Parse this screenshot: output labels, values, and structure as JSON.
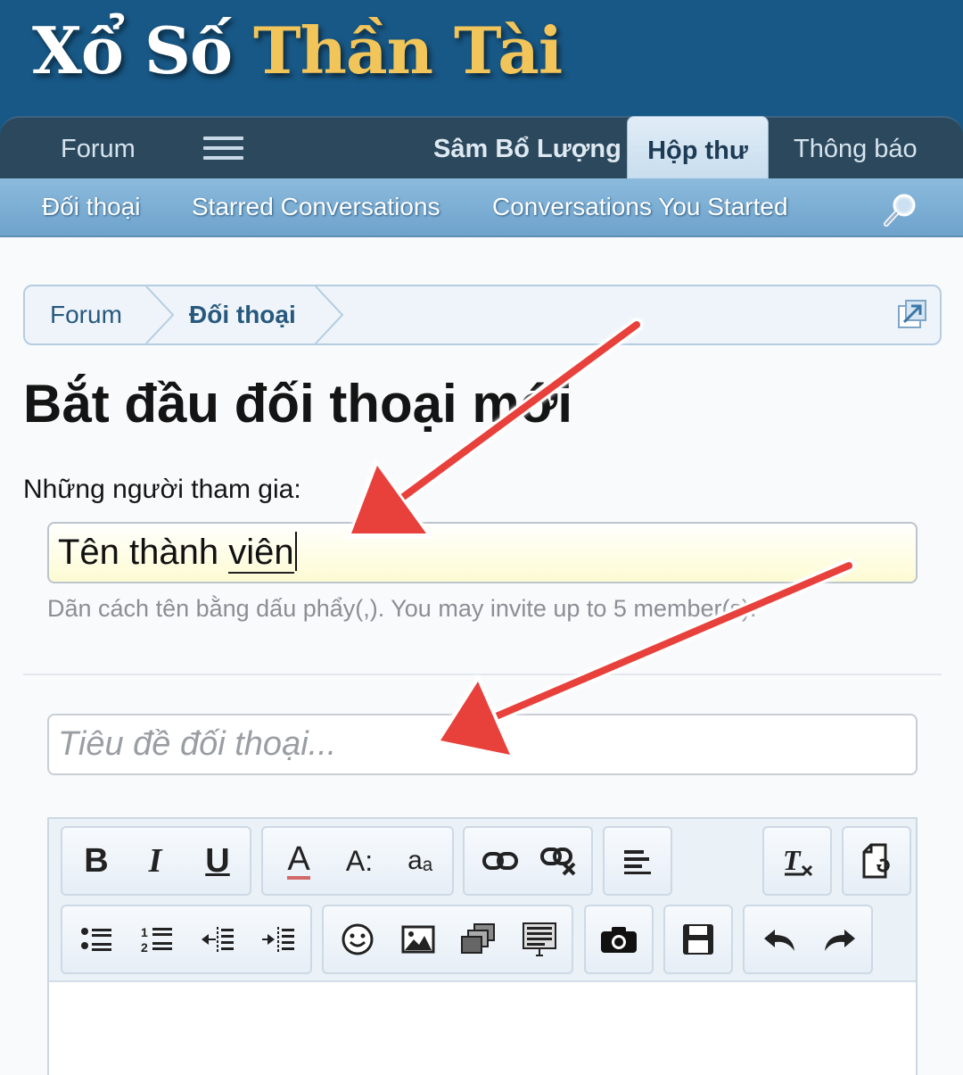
{
  "header": {
    "logo_part1": "Xổ Số ",
    "logo_part2": "Thần Tài"
  },
  "nav": {
    "forum": "Forum",
    "menu_icon": "hamburger-icon",
    "sam": "Sâm Bổ Lượng",
    "hop_thu": "Hộp thư",
    "thong_bao": "Thông báo"
  },
  "subnav": {
    "doi_thoai": "Đối thoại",
    "starred": "Starred Conversations",
    "started": "Conversations You Started",
    "search_icon": "search-icon"
  },
  "breadcrumb": {
    "forum": "Forum",
    "doi_thoai": "Đối thoại"
  },
  "page": {
    "title": "Bắt đầu đối thoại mới"
  },
  "form": {
    "participants_label": "Những người tham gia:",
    "participants_value_1": "Tên thành ",
    "participants_value_2": "viên",
    "participants_hint": "Dãn cách tên bằng dấu phẩy(,). You may invite up to 5 member(s).",
    "title_placeholder": "Tiêu đề đối thoại..."
  },
  "toolbar": {
    "bold": "B",
    "italic": "I",
    "underline": "U",
    "font_color": "A",
    "font_size": "A:",
    "font_family": "aₐ",
    "icons": [
      "link-icon",
      "unlink-icon",
      "align-icon",
      "remove-format-icon",
      "restore-draft-icon",
      "bullet-list-icon",
      "numbered-list-icon",
      "outdent-icon",
      "indent-icon",
      "smiley-icon",
      "image-icon",
      "media-icon",
      "bbcode-icon",
      "camera-icon",
      "save-icon",
      "undo-icon",
      "redo-icon"
    ]
  },
  "colors": {
    "header_bg": "#185886",
    "nav_bg": "#2b485c",
    "subnav_bg": "#7aaed4",
    "logo_gold": "#f2c55a",
    "arrow_red": "#e8413a"
  }
}
